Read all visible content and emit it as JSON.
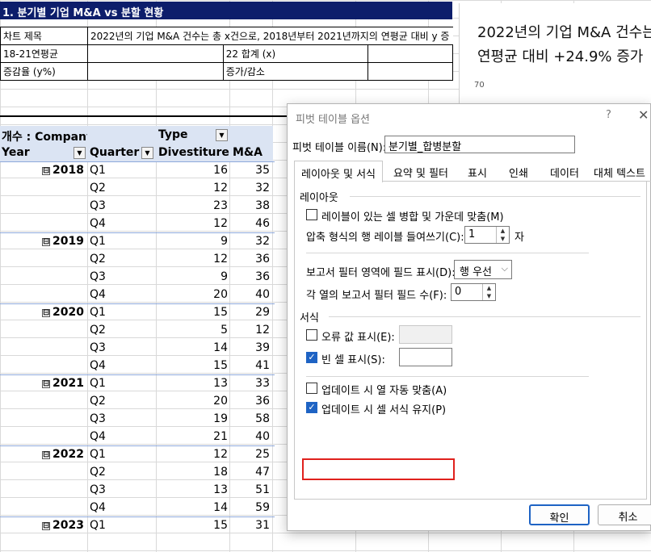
{
  "sheet": {
    "title": "1. 분기별 기업 M&A vs 분할 현황",
    "info": [
      [
        "차트 제목",
        "2022년의 기업 M&A 건수는 총 x건으로, 2018년부터 2021년까지의 연평균 대비 y 증",
        "",
        ""
      ],
      [
        "18-21연평균",
        "",
        "22 합계 (x)",
        ""
      ],
      [
        "증감율 (y%)",
        "",
        "증가/감소",
        ""
      ]
    ]
  },
  "pivot": {
    "header1": {
      "value_label": "개수 : Company",
      "type_label": "Type"
    },
    "header2": {
      "year": "Year",
      "quarter": "Quarter",
      "divestiture": "Divestiture",
      "ma": "M&A"
    },
    "collapse_symbol": "⊟",
    "rows": [
      {
        "year": "2018",
        "q": "Q1",
        "d": "16",
        "m": "35"
      },
      {
        "year": "",
        "q": "Q2",
        "d": "12",
        "m": "32"
      },
      {
        "year": "",
        "q": "Q3",
        "d": "23",
        "m": "38"
      },
      {
        "year": "",
        "q": "Q4",
        "d": "12",
        "m": "46"
      },
      {
        "year": "2019",
        "q": "Q1",
        "d": "9",
        "m": "32"
      },
      {
        "year": "",
        "q": "Q2",
        "d": "12",
        "m": "36"
      },
      {
        "year": "",
        "q": "Q3",
        "d": "9",
        "m": "36"
      },
      {
        "year": "",
        "q": "Q4",
        "d": "20",
        "m": "40"
      },
      {
        "year": "2020",
        "q": "Q1",
        "d": "15",
        "m": "29"
      },
      {
        "year": "",
        "q": "Q2",
        "d": "5",
        "m": "12"
      },
      {
        "year": "",
        "q": "Q3",
        "d": "14",
        "m": "39"
      },
      {
        "year": "",
        "q": "Q4",
        "d": "15",
        "m": "41"
      },
      {
        "year": "2021",
        "q": "Q1",
        "d": "13",
        "m": "33"
      },
      {
        "year": "",
        "q": "Q2",
        "d": "20",
        "m": "36"
      },
      {
        "year": "",
        "q": "Q3",
        "d": "19",
        "m": "58"
      },
      {
        "year": "",
        "q": "Q4",
        "d": "21",
        "m": "40"
      },
      {
        "year": "2022",
        "q": "Q1",
        "d": "12",
        "m": "25"
      },
      {
        "year": "",
        "q": "Q2",
        "d": "18",
        "m": "47"
      },
      {
        "year": "",
        "q": "Q3",
        "d": "13",
        "m": "51"
      },
      {
        "year": "",
        "q": "Q4",
        "d": "14",
        "m": "59"
      },
      {
        "year": "2023",
        "q": "Q1",
        "d": "15",
        "m": "31"
      }
    ]
  },
  "chart": {
    "title_line1": "2022년의 기업 M&A 건수는",
    "title_line2": "연평균 대비 +24.9% 증가",
    "tick_label": "70"
  },
  "dialog": {
    "title": "피벗 테이블 옵션",
    "help": "?",
    "close": "✕",
    "name_label": "피벗 테이블 이름(N):",
    "name_value": "분기별_합병분할",
    "tabs": [
      "레이아웃 및 서식",
      "요약 및 필터",
      "표시",
      "인쇄",
      "데이터",
      "대체 텍스트"
    ],
    "layout_section": "레이아웃",
    "merge_label": "레이블이 있는 셀 병합 및 가운데 맞춤(M)",
    "merge_checked": false,
    "indent_label": "압축 형식의 행 레이블 들여쓰기(C):",
    "indent_value": "1",
    "indent_unit": "자",
    "filter_area_label": "보고서 필터 영역에 필드 표시(D):",
    "filter_area_value": "행 우선",
    "filter_count_label": "각 열의 보고서 필터 필드 수(F):",
    "filter_count_value": "0",
    "format_section": "서식",
    "error_label": "오류 값 표시(E):",
    "error_checked": false,
    "empty_label": "빈 셀 표시(S):",
    "empty_checked": true,
    "autofit_label": "업데이트 시 열 자동 맞춤(A)",
    "autofit_checked": false,
    "preserve_label": "업데이트 시 셀 서식 유지(P)",
    "preserve_checked": true,
    "ok": "확인",
    "cancel": "취소"
  }
}
